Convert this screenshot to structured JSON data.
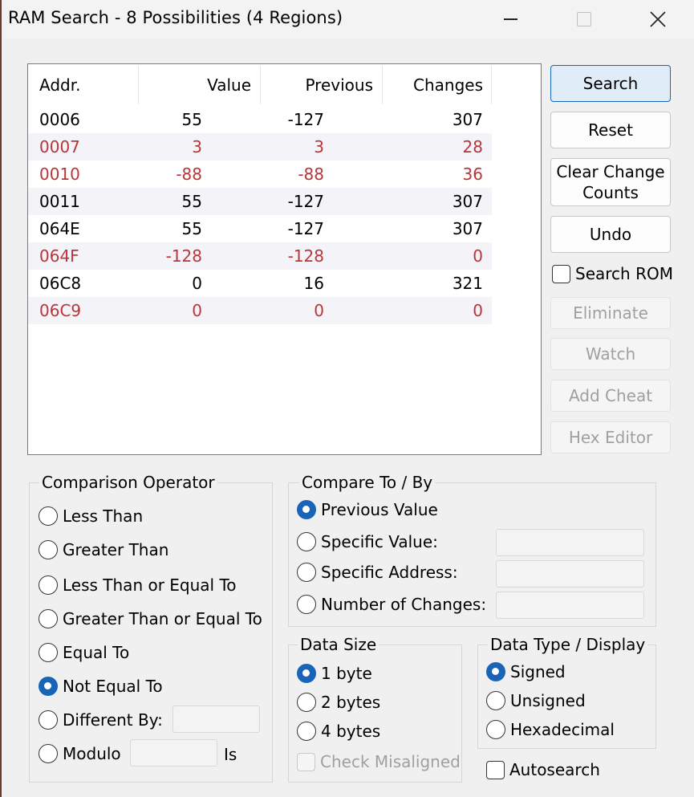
{
  "window": {
    "title": "RAM Search - 8 Possibilities (4 Regions)",
    "controls": [
      "minimize-icon",
      "maximize-icon",
      "close-icon"
    ]
  },
  "list": {
    "columns": [
      "Addr.",
      "Value",
      "Previous",
      "Changes"
    ],
    "rows": [
      {
        "addr": "0006",
        "value": "55",
        "previous": "-127",
        "changes": "307",
        "highlight": false
      },
      {
        "addr": "0007",
        "value": "3",
        "previous": "3",
        "changes": "28",
        "highlight": true
      },
      {
        "addr": "0010",
        "value": "-88",
        "previous": "-88",
        "changes": "36",
        "highlight": true
      },
      {
        "addr": "0011",
        "value": "55",
        "previous": "-127",
        "changes": "307",
        "highlight": false
      },
      {
        "addr": "064E",
        "value": "55",
        "previous": "-127",
        "changes": "307",
        "highlight": false
      },
      {
        "addr": "064F",
        "value": "-128",
        "previous": "-128",
        "changes": "0",
        "highlight": true
      },
      {
        "addr": "06C8",
        "value": "0",
        "previous": "16",
        "changes": "321",
        "highlight": false
      },
      {
        "addr": "06C9",
        "value": "0",
        "previous": "0",
        "changes": "0",
        "highlight": true
      }
    ]
  },
  "buttons": {
    "search": "Search",
    "reset": "Reset",
    "clear_change_counts": "Clear Change Counts",
    "undo": "Undo",
    "search_rom": "Search ROM",
    "eliminate": "Eliminate",
    "watch": "Watch",
    "add_cheat": "Add Cheat",
    "hex_editor": "Hex Editor"
  },
  "comparison": {
    "title": "Comparison Operator",
    "options": [
      "Less Than",
      "Greater Than",
      "Less Than or Equal To",
      "Greater Than or Equal To",
      "Equal To",
      "Not Equal To",
      "Different By:",
      "Modulo"
    ],
    "selected": "Not Equal To",
    "modulo_is": "Is"
  },
  "compare_to": {
    "title": "Compare To / By",
    "options": [
      "Previous Value",
      "Specific Value:",
      "Specific Address:",
      "Number of Changes:"
    ],
    "selected": "Previous Value"
  },
  "data_size": {
    "title": "Data Size",
    "options": [
      "1 byte",
      "2 bytes",
      "4 bytes"
    ],
    "selected": "1 byte",
    "check_misaligned": "Check Misaligned"
  },
  "data_type": {
    "title": "Data Type / Display",
    "options": [
      "Signed",
      "Unsigned",
      "Hexadecimal"
    ],
    "selected": "Signed"
  },
  "autosearch": "Autosearch",
  "colors": {
    "highlight_row_text": "#b8363a",
    "accent": "#1a64b8"
  }
}
